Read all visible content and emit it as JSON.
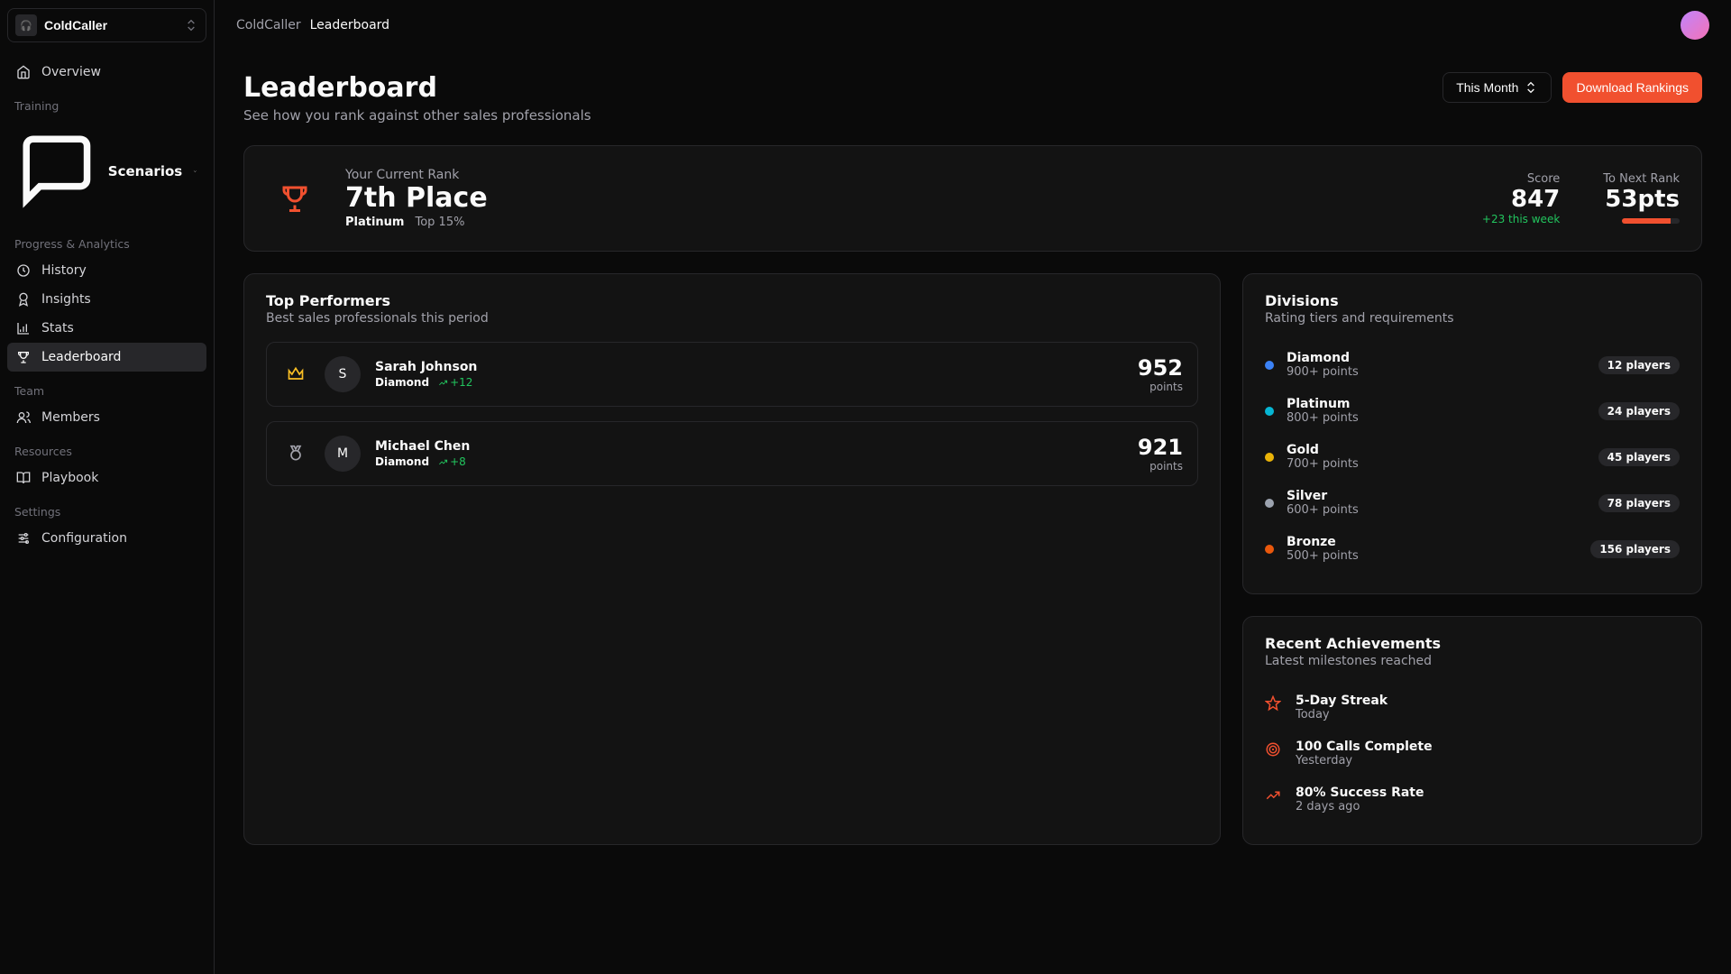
{
  "workspace": {
    "name": "ColdCaller"
  },
  "breadcrumb": {
    "app": "ColdCaller",
    "page": "Leaderboard"
  },
  "sidebar": {
    "overview": "Overview",
    "groups": {
      "training": {
        "label": "Training",
        "scenarios": "Scenarios"
      },
      "progress": {
        "label": "Progress & Analytics",
        "history": "History",
        "insights": "Insights",
        "stats": "Stats",
        "leaderboard": "Leaderboard"
      },
      "team": {
        "label": "Team",
        "members": "Members"
      },
      "resources": {
        "label": "Resources",
        "playbook": "Playbook"
      },
      "settings": {
        "label": "Settings",
        "configuration": "Configuration"
      }
    }
  },
  "page": {
    "title": "Leaderboard",
    "subtitle": "See how you rank against other sales professionals",
    "period_selector": "This Month",
    "download_btn": "Download Rankings"
  },
  "rank_card": {
    "label": "Your Current Rank",
    "rank": "7th Place",
    "tier": "Platinum",
    "percentile": "Top 15%",
    "score_label": "Score",
    "score": "847",
    "score_delta": "+23 this week",
    "next_label": "To Next Rank",
    "next_pts": "53pts"
  },
  "top_performers": {
    "title": "Top Performers",
    "desc": "Best sales professionals this period",
    "points_label": "points",
    "items": [
      {
        "initial": "S",
        "name": "Sarah Johnson",
        "tier": "Diamond",
        "delta": "+12",
        "score": "952"
      },
      {
        "initial": "M",
        "name": "Michael Chen",
        "tier": "Diamond",
        "delta": "+8",
        "score": "921"
      }
    ]
  },
  "divisions": {
    "title": "Divisions",
    "desc": "Rating tiers and requirements",
    "items": [
      {
        "name": "Diamond",
        "req": "900+ points",
        "count": "12 players",
        "color": "#3b82f6"
      },
      {
        "name": "Platinum",
        "req": "800+ points",
        "count": "24 players",
        "color": "#06b6d4"
      },
      {
        "name": "Gold",
        "req": "700+ points",
        "count": "45 players",
        "color": "#eab308"
      },
      {
        "name": "Silver",
        "req": "600+ points",
        "count": "78 players",
        "color": "#9ca3af"
      },
      {
        "name": "Bronze",
        "req": "500+ points",
        "count": "156 players",
        "color": "#ea580c"
      }
    ]
  },
  "achievements": {
    "title": "Recent Achievements",
    "desc": "Latest milestones reached",
    "items": [
      {
        "icon": "star",
        "title": "5-Day Streak",
        "time": "Today"
      },
      {
        "icon": "target",
        "title": "100 Calls Complete",
        "time": "Yesterday"
      },
      {
        "icon": "trending",
        "title": "80% Success Rate",
        "time": "2 days ago"
      }
    ]
  }
}
